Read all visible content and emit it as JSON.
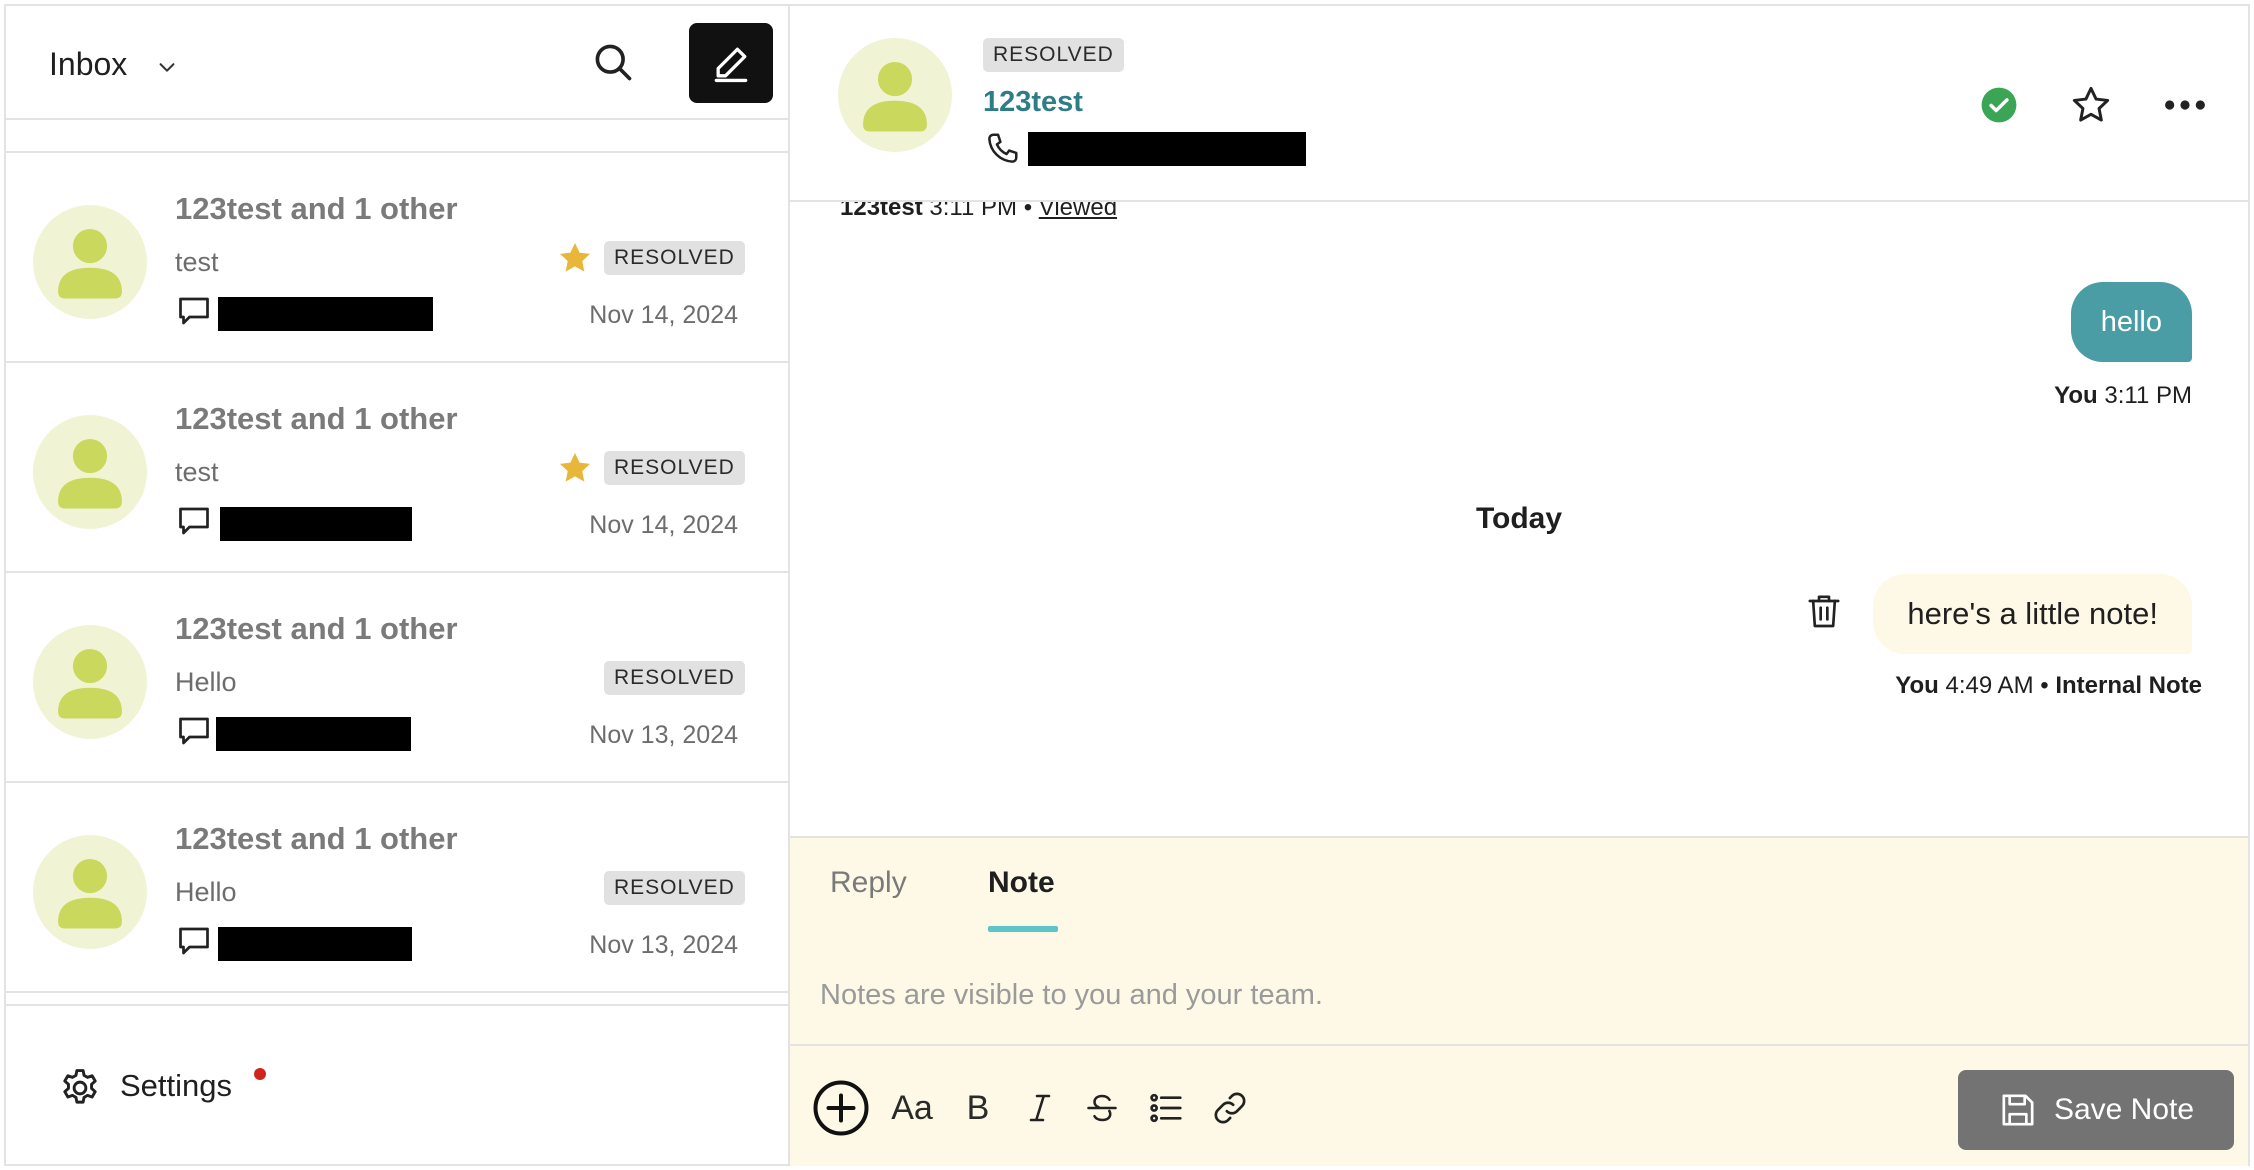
{
  "inbox": {
    "title": "Inbox",
    "conversations": [
      {
        "name": "123test and 1 other",
        "preview": "test",
        "status": "RESOLVED",
        "starred": true,
        "date": "Nov 14, 2024"
      },
      {
        "name": "123test and 1 other",
        "preview": "test",
        "status": "RESOLVED",
        "starred": true,
        "date": "Nov 14, 2024"
      },
      {
        "name": "123test and 1 other",
        "preview": "Hello",
        "status": "RESOLVED",
        "starred": false,
        "date": "Nov 13, 2024"
      },
      {
        "name": "123test and 1 other",
        "preview": "Hello",
        "status": "RESOLVED",
        "starred": false,
        "date": "Nov 13, 2024"
      }
    ],
    "settings_label": "Settings"
  },
  "conversation": {
    "status": "RESOLVED",
    "contact_name": "123test",
    "previous_meta": {
      "sender": "123test",
      "time": "3:11 PM",
      "separator": "•",
      "status": "Viewed"
    },
    "messages": [
      {
        "text": "hello",
        "sender": "You",
        "time": "3:11 PM"
      }
    ],
    "day_divider": "Today",
    "note": {
      "text": "here's a little note!",
      "sender": "You",
      "time": "4:49 AM",
      "separator": "•",
      "label": "Internal Note"
    }
  },
  "composer": {
    "tabs": {
      "reply": "Reply",
      "note": "Note"
    },
    "active_tab": "Note",
    "placeholder": "Notes are visible to you and your team.",
    "format_aa": "Aa",
    "format_bold": "B",
    "save_label": "Save Note"
  },
  "colors": {
    "accent": "#4a9da4",
    "note_background": "#fdf9e6",
    "star": "#e8b73a",
    "resolved_check": "#3aa655",
    "notification_dot": "#d0241d"
  }
}
